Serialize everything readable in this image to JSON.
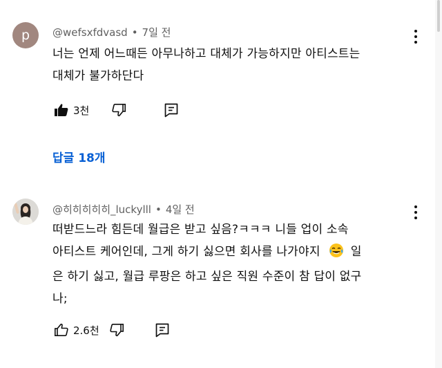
{
  "comments": [
    {
      "avatar_letter": "p",
      "avatar_color": "#a1877f",
      "author": "@wefsxfdvasd",
      "time": "7일 전",
      "lines": [
        "너는 언제 어느때든 아무나하고 대체가 가능하지만 아티스트는",
        "대체가 불가하단다"
      ],
      "like_count": "3천",
      "replies_label": "답글 18개"
    },
    {
      "author": "@히히히히히_luckylll",
      "time": "4일 전",
      "lines": [
        "떠받드느라 힘든데 월급은 받고 싶음?ㅋㅋㅋ 니들 업이 소속",
        "아티스트 케어인데, 그게 하기 싫으면 회사를 나가야지",
        "은 하기 싫고, 월급 루팡은 하고 싶은 직원 수준이 참 답이 없구",
        "나;"
      ],
      "line2_tail": "일",
      "emoji": "face-with-tears-of-joy",
      "like_count": "2.6천"
    }
  ],
  "separator": "•"
}
